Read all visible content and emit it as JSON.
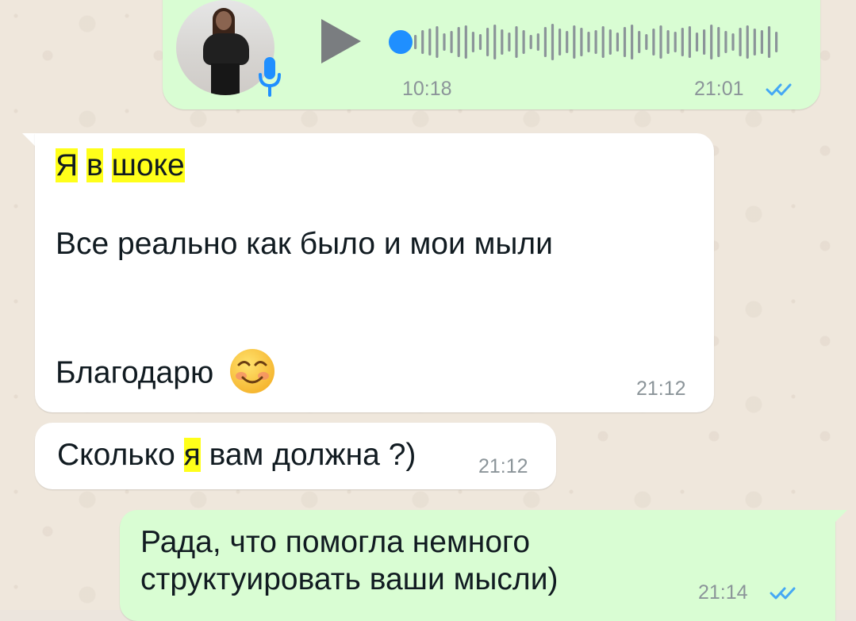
{
  "colors": {
    "outgoing_bubble": "#d9fdd3",
    "incoming_bubble": "#ffffff",
    "highlight": "#ffff1a",
    "read_ticks": "#45a8f4",
    "voice_dot": "#1f8fff"
  },
  "voice_message": {
    "duration": "10:18",
    "time": "21:01",
    "status": "read"
  },
  "messages": [
    {
      "direction": "incoming",
      "lines": [
        [
          "Я",
          "в",
          "шоке"
        ],
        "Все реально как было и мои мыли",
        "Благодарю"
      ],
      "emoji": "smiling-face-with-smiling-eyes",
      "time": "21:12"
    },
    {
      "direction": "incoming",
      "parts": [
        "Сколько",
        "я",
        "вам должна ?)"
      ],
      "time": "21:12"
    },
    {
      "direction": "outgoing",
      "lines": [
        "Рада, что помогла немного",
        "структуировать ваши мысли)"
      ],
      "time": "21:14",
      "status": "read"
    }
  ]
}
